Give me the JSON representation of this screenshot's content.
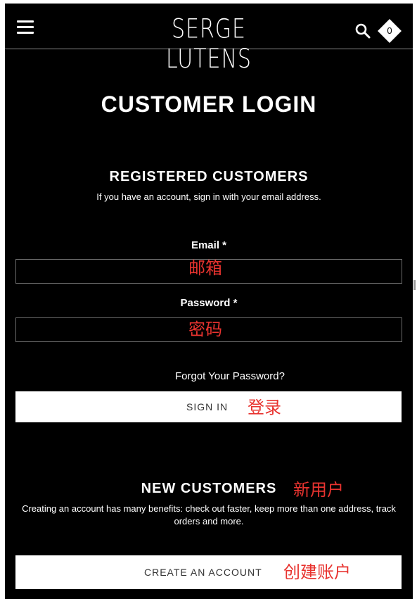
{
  "header": {
    "logo_text": "SERGE LUTENS",
    "cart_count": "0"
  },
  "page": {
    "title": "CUSTOMER LOGIN"
  },
  "registered": {
    "title": "REGISTERED CUSTOMERS",
    "description": "If you have an account, sign in with your email address.",
    "email_label": "Email",
    "email_required": "*",
    "email_value": "",
    "email_annotation": "邮箱",
    "password_label": "Password",
    "password_required": "*",
    "password_value": "",
    "password_annotation": "密码",
    "forgot_link": "Forgot Your Password?",
    "sign_in_label": "SIGN IN",
    "sign_in_annotation": "登录"
  },
  "new_customers": {
    "title": "NEW CUSTOMERS",
    "title_annotation": "新用户",
    "description": "Creating an account has many benefits: check out faster, keep more than one address, track orders and more.",
    "create_label": "CREATE AN ACCOUNT",
    "create_annotation": "创建账户"
  },
  "colors": {
    "background": "#000000",
    "text": "#ffffff",
    "annotation": "#e8332f",
    "button_bg": "#ffffff"
  }
}
